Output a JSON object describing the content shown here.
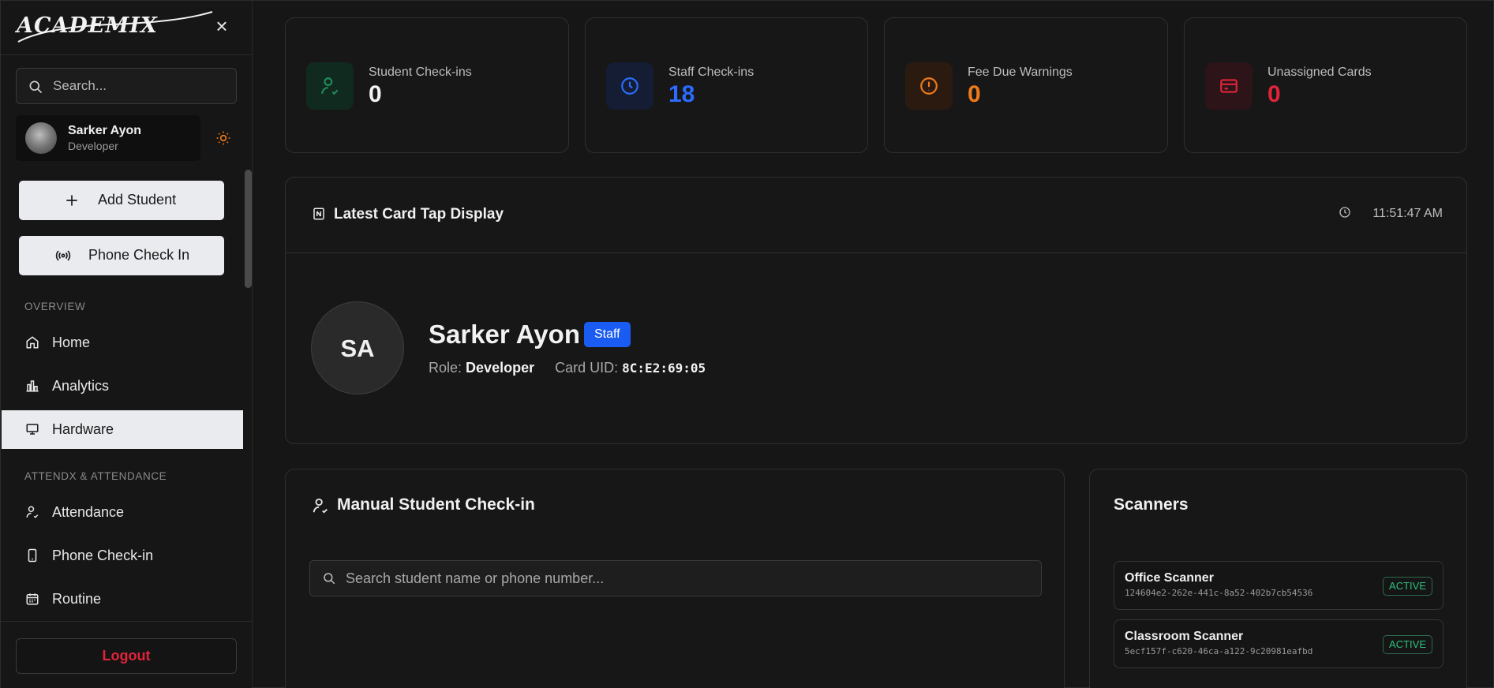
{
  "sidebar": {
    "brand": "ACADEMIX",
    "search_placeholder": "Search...",
    "user": {
      "name": "Sarker Ayon",
      "role": "Developer"
    },
    "buttons": {
      "add_student": "Add Student",
      "phone_check_in": "Phone Check In"
    },
    "sections": {
      "overview": "OVERVIEW",
      "attendance": "ATTENDX & ATTENDANCE"
    },
    "nav_overview": [
      {
        "label": "Home",
        "icon": "home-icon"
      },
      {
        "label": "Analytics",
        "icon": "bar-chart-icon"
      },
      {
        "label": "Hardware",
        "icon": "monitor-icon",
        "active": true
      }
    ],
    "nav_attendance": [
      {
        "label": "Attendance",
        "icon": "user-check-icon"
      },
      {
        "label": "Phone Check-in",
        "icon": "smartphone-icon"
      },
      {
        "label": "Routine",
        "icon": "calendar-icon"
      }
    ],
    "logout": "Logout"
  },
  "stats": [
    {
      "title": "Student Check-ins",
      "value": "0",
      "color": "#f2f2f2",
      "icon": "user-check-icon",
      "accent": "#1f8a5b"
    },
    {
      "title": "Staff Check-ins",
      "value": "18",
      "color": "#2b6bff",
      "icon": "clock-icon",
      "accent": "#2b6bff"
    },
    {
      "title": "Fee Due Warnings",
      "value": "0",
      "color": "#f07a1a",
      "icon": "alert-circle-icon",
      "accent": "#f07a1a"
    },
    {
      "title": "Unassigned Cards",
      "value": "0",
      "color": "#e0243a",
      "icon": "credit-card-icon",
      "accent": "#e0243a"
    }
  ],
  "latest_tap": {
    "title": "Latest Card Tap Display",
    "time": "11:51:47 AM",
    "initials": "SA",
    "name": "Sarker Ayon",
    "badge": "Staff",
    "role_label": "Role:",
    "role": "Developer",
    "uid_label": "Card UID:",
    "uid": "8C:E2:69:05"
  },
  "manual_checkin": {
    "title": "Manual Student Check-in",
    "search_placeholder": "Search student name or phone number..."
  },
  "scanners": {
    "title": "Scanners",
    "items": [
      {
        "name": "Office Scanner",
        "id": "124604e2-262e-441c-8a52-402b7cb54536",
        "status": "ACTIVE"
      },
      {
        "name": "Classroom Scanner",
        "id": "5ecf157f-c620-46ca-a122-9c20981eafbd",
        "status": "ACTIVE"
      }
    ]
  }
}
